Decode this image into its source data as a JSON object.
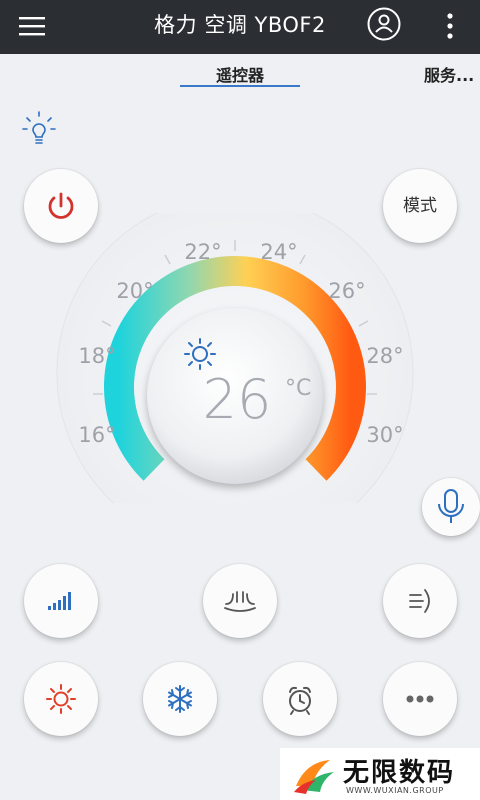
{
  "header": {
    "title": "格力 空调 YBOF2"
  },
  "tabs": [
    {
      "label": "遥控器",
      "active": true
    },
    {
      "label": "服务..."
    }
  ],
  "buttons": {
    "mode_label": "模式"
  },
  "dial": {
    "current_temp": "26",
    "unit": "°C",
    "ticks": [
      "16°",
      "18°",
      "20°",
      "22°",
      "24°",
      "26°",
      "28°",
      "30°"
    ]
  },
  "watermark": {
    "title": "无限数码",
    "subtitle": "WWW.WUXIAN.GROUP"
  },
  "colors": {
    "topbar": "#2b2e33",
    "tab_underline": "#3a78c9",
    "power_red": "#d2332c",
    "icon_blue": "#2e6fc0",
    "sun_red": "#e0402a",
    "gauge_start": "#1fd3dc",
    "gauge_end": "#ff5a12"
  },
  "icons": [
    "menu-icon",
    "user-icon",
    "more-icon",
    "bulb-icon",
    "power-icon",
    "mic-icon",
    "signal-bars-icon",
    "swing-icon",
    "wind-direction-icon",
    "heat-sun-icon",
    "snowflake-icon",
    "alarm-clock-icon",
    "ellipsis-icon"
  ]
}
